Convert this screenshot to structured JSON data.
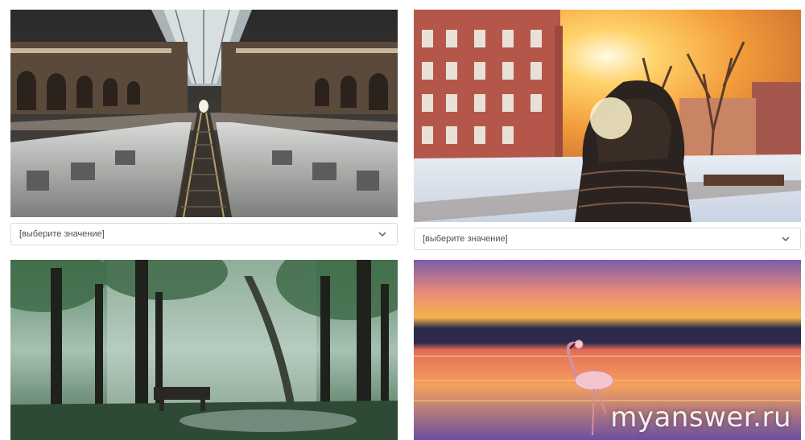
{
  "tiles": [
    {
      "subject": "railway-station",
      "select_placeholder": "[выберите значение]"
    },
    {
      "subject": "winter-sunset",
      "select_placeholder": "[выберите значение]"
    },
    {
      "subject": "foggy-forest"
    },
    {
      "subject": "flamingo-sunset"
    }
  ],
  "watermark": "myanswer.ru",
  "colors": {
    "border": "#d7dbe1",
    "select_text": "#4b4f55",
    "chevron": "#6b7078"
  }
}
